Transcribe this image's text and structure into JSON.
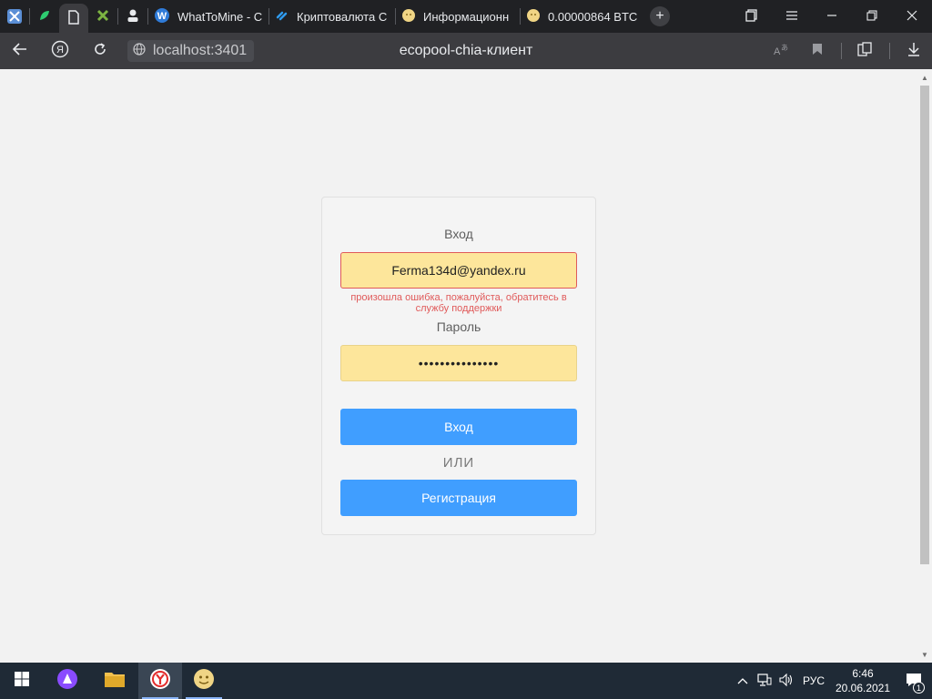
{
  "browser": {
    "tabs": [
      {
        "label": "",
        "icon": "app-icon-blue-x"
      },
      {
        "label": "",
        "icon": "green-leaf-icon"
      },
      {
        "label": "",
        "icon": "document-icon",
        "active": true
      },
      {
        "label": "",
        "icon": "green-cross-icon"
      },
      {
        "label": "",
        "icon": "user-icon"
      },
      {
        "label": "WhatToMine - C",
        "icon": "wordpress-icon"
      },
      {
        "label": "Криптовалюта С",
        "icon": "blue-chain-icon"
      },
      {
        "label": "Информационн",
        "icon": "coin-face-icon"
      },
      {
        "label": "0.00000864 BTC",
        "icon": "coin-face-icon"
      }
    ],
    "new_tab_symbol": "+",
    "url": "localhost:3401",
    "page_title": "ecopool-chia-клиент"
  },
  "login": {
    "login_label": "Вход",
    "email_value": "Ferma134d@yandex.ru",
    "error_message": "произошла ошибка, пожалуйста, обратитесь в службу поддержки",
    "password_label": "Пароль",
    "password_value": "•••••••••••••••",
    "submit_label": "Вход",
    "or_label": "ИЛИ",
    "register_label": "Регистрация"
  },
  "taskbar": {
    "language": "РУС",
    "time": "6:46",
    "date": "20.06.2021",
    "notification_count": "1"
  },
  "colors": {
    "primary_button": "#409eff",
    "input_autofill": "#fde69b",
    "error": "#e05a5a"
  }
}
